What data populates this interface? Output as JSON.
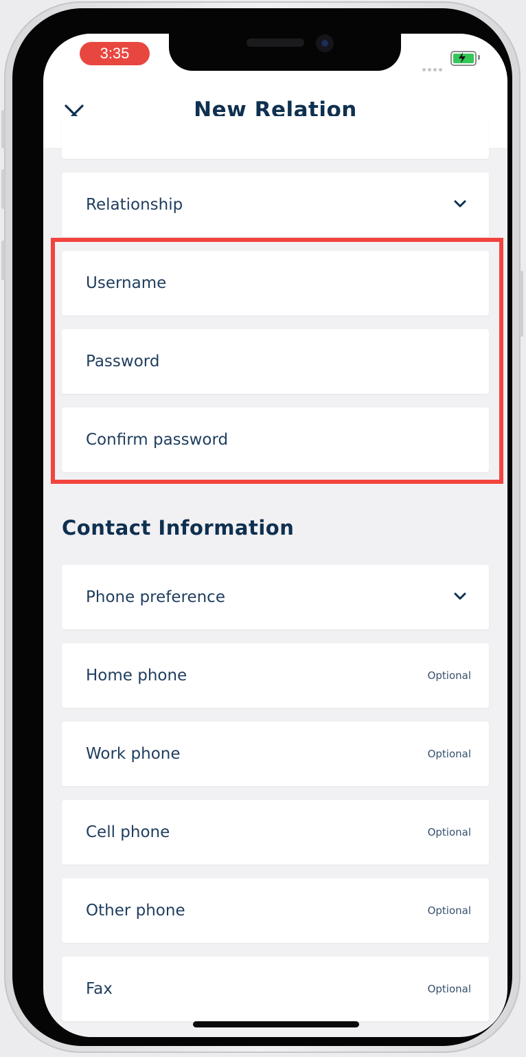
{
  "status": {
    "time": "3:35",
    "colors": {
      "time_pill": "#e8473f",
      "battery": "#34c759"
    }
  },
  "nav": {
    "title": "New Relation",
    "close_icon": "close-icon"
  },
  "account_fields": {
    "relationship": {
      "label": "Relationship",
      "icon": "chevron-down-icon"
    },
    "username": {
      "label": "Username"
    },
    "password": {
      "label": "Password"
    },
    "confirm_password": {
      "label": "Confirm password"
    }
  },
  "contact": {
    "section_title": "Contact Information",
    "phone_preference": {
      "label": "Phone preference",
      "icon": "chevron-down-icon"
    },
    "fields": [
      {
        "label": "Home phone",
        "hint": "Optional"
      },
      {
        "label": "Work phone",
        "hint": "Optional"
      },
      {
        "label": "Cell phone",
        "hint": "Optional"
      },
      {
        "label": "Other phone",
        "hint": "Optional"
      },
      {
        "label": "Fax",
        "hint": "Optional"
      }
    ]
  },
  "colors": {
    "text_primary": "#0f3050",
    "field_label": "#1f3d5e",
    "highlight_border": "#f2443e",
    "screen_background": "#f1f0f3"
  }
}
